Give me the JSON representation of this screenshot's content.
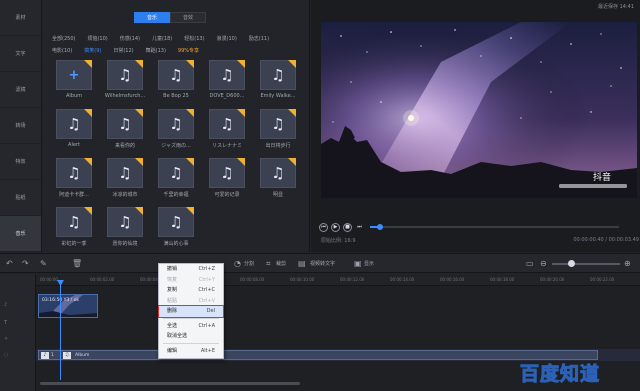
{
  "window": {
    "top_right_text": "最近保存 14:41"
  },
  "sidebar": {
    "items": [
      {
        "label": "素材"
      },
      {
        "label": "文字"
      },
      {
        "label": "滤镜"
      },
      {
        "label": "转场"
      },
      {
        "label": "特效"
      },
      {
        "label": "贴纸"
      },
      {
        "label": "音乐"
      }
    ],
    "active_index": 6
  },
  "library": {
    "segments": [
      {
        "label": "音乐"
      },
      {
        "label": "音效"
      }
    ],
    "filters_row1": [
      "全部(250)",
      "烦恼(10)",
      "伤感(14)",
      "儿童(18)",
      "轻松(13)",
      "浪漫(10)",
      "励志(11)"
    ],
    "filters_row2": [
      "电影(10)",
      "搞笑(9)",
      "日常(12)",
      "舞蹈(13)",
      "99%专享"
    ],
    "selected_filter": "搞笑(9)",
    "items": [
      {
        "caption": "Album",
        "type": "add"
      },
      {
        "caption": "Wilhelmsfurch...",
        "type": "music"
      },
      {
        "caption": "Be Bop 25",
        "type": "music"
      },
      {
        "caption": "DOVE_D600...",
        "type": "music"
      },
      {
        "caption": "Emily Walke...",
        "type": "music"
      },
      {
        "caption": "Alert",
        "type": "music"
      },
      {
        "caption": "来看你的",
        "type": "music"
      },
      {
        "caption": "ジャズ雨の...",
        "type": "music"
      },
      {
        "caption": "リスレナナミ",
        "type": "music"
      },
      {
        "caption": "出日将步行",
        "type": "music"
      },
      {
        "caption": "阿迪卡卡群...",
        "type": "music"
      },
      {
        "caption": "冰凉的城市",
        "type": "music"
      },
      {
        "caption": "千里的幸福",
        "type": "music"
      },
      {
        "caption": "可爱的记录",
        "type": "music"
      },
      {
        "caption": "明显",
        "type": "music"
      },
      {
        "caption": "彩虹的一季",
        "type": "music"
      },
      {
        "caption": "愿你的仙境",
        "type": "music"
      },
      {
        "caption": "满山的心事",
        "type": "music"
      }
    ]
  },
  "preview": {
    "watermark_app": "抖音",
    "time_left": "原始比例:  16:9",
    "time_right": "00:00:00.40 / 00:00:03.49",
    "progress": 0.04
  },
  "toolbar": {
    "buttons": [
      "分割",
      "裁剪",
      "视频转文字",
      "显示"
    ]
  },
  "timeline": {
    "ruler": [
      "00:00:00",
      "00:00:02.00",
      "00:00:04.00",
      "00:00:06.00",
      "00:00:08.00",
      "00:00:10.00",
      "00:00:12.00",
      "00:00:14.00",
      "00:00:16.00",
      "00:00:18.00",
      "00:00:20.00",
      "00:00:22.00"
    ],
    "video_clip_label": "03:16:50 Y3 / ok",
    "audio_clip_label": "Album",
    "audio_track_num": "1",
    "track_labels": [
      "♪",
      "T",
      "✧",
      "◌"
    ]
  },
  "context_menu": {
    "items": [
      {
        "label": "撤销",
        "shortcut": "Ctrl+Z",
        "disabled": false,
        "highlighted": false
      },
      {
        "label": "恢复",
        "shortcut": "Ctrl+Y",
        "disabled": true,
        "highlighted": false
      },
      {
        "label": "复制",
        "shortcut": "Ctrl+C",
        "disabled": false,
        "highlighted": false
      },
      {
        "label": "粘贴",
        "shortcut": "Ctrl+V",
        "disabled": true,
        "highlighted": false
      },
      {
        "label": "删除",
        "shortcut": "Del",
        "disabled": false,
        "highlighted": true
      },
      {
        "label": "全选",
        "shortcut": "Ctrl+A",
        "disabled": false,
        "highlighted": false
      },
      {
        "label": "取消全选",
        "shortcut": "",
        "disabled": false,
        "highlighted": false
      },
      {
        "label": "编辑",
        "shortcut": "Alt+E",
        "disabled": false,
        "highlighted": false
      }
    ]
  },
  "site_watermark": {
    "text": "百度知道"
  }
}
